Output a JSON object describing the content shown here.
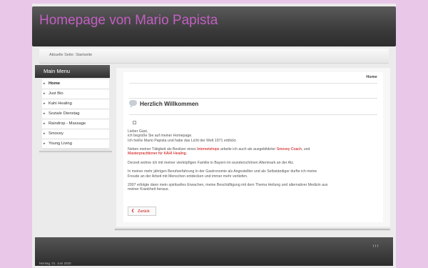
{
  "site": {
    "title": "Homepage von Mario Papista"
  },
  "breadcrumbs": [
    "Aktuelle Seite:",
    "Startseite"
  ],
  "sidebar": {
    "title": "Main Menu",
    "items": [
      {
        "label": "Home"
      },
      {
        "label": "Just Bio"
      },
      {
        "label": "Kahi Healing"
      },
      {
        "label": "Soziale Dienstag"
      },
      {
        "label": "Raindrop - Massage"
      },
      {
        "label": "Smovey"
      },
      {
        "label": "Young Living"
      }
    ]
  },
  "content": {
    "home_crumb": "Home",
    "heading": "Herzlich Willkommen",
    "p1_l1": "Lieber Gast,",
    "p1_l2": "ich begrüße Sie auf meiner Homepage.",
    "p1_l3": "Ich heiße Mario Papista und habe das Licht der Welt 1971 erblickt.",
    "p2_a": "Neben meiner Tätigkeit als Besitzer eines ",
    "p2_link1": "Internetshops",
    "p2_b": " arbeite ich auch als ausgebildeter ",
    "p2_link2": "Smovey Coach",
    "p2_c": ", und",
    "p2_link3": "Masterpractitioner für KAHI Healing",
    "p2_d": ".",
    "p3": "Derzeit wohne ich mit meiner vierköpfigen Familie in Bayern im wunderschönen Altenmark an der Alz.",
    "p4_l1": "In meiner mehr jährigen Berufserfahrung in der Gastronomie als Angestellter und als Selbständiger durfte ich meine",
    "p4_l2": "Freude an der Arbeit mit Menschen entdecken und immer mehr vertiefen.",
    "p5_l1": "2007 erfolgte dann mein spirituelles Erwachen, meine Beschäftigung mit dem Thema Heilung und alternativer Medizin aus",
    "p5_l2": "meiner Krankheit heraus.",
    "back_label": "Zurück"
  },
  "footer": {
    "to_top": "↑↑↑",
    "date": "Montag, 01. Juni 2020"
  }
}
